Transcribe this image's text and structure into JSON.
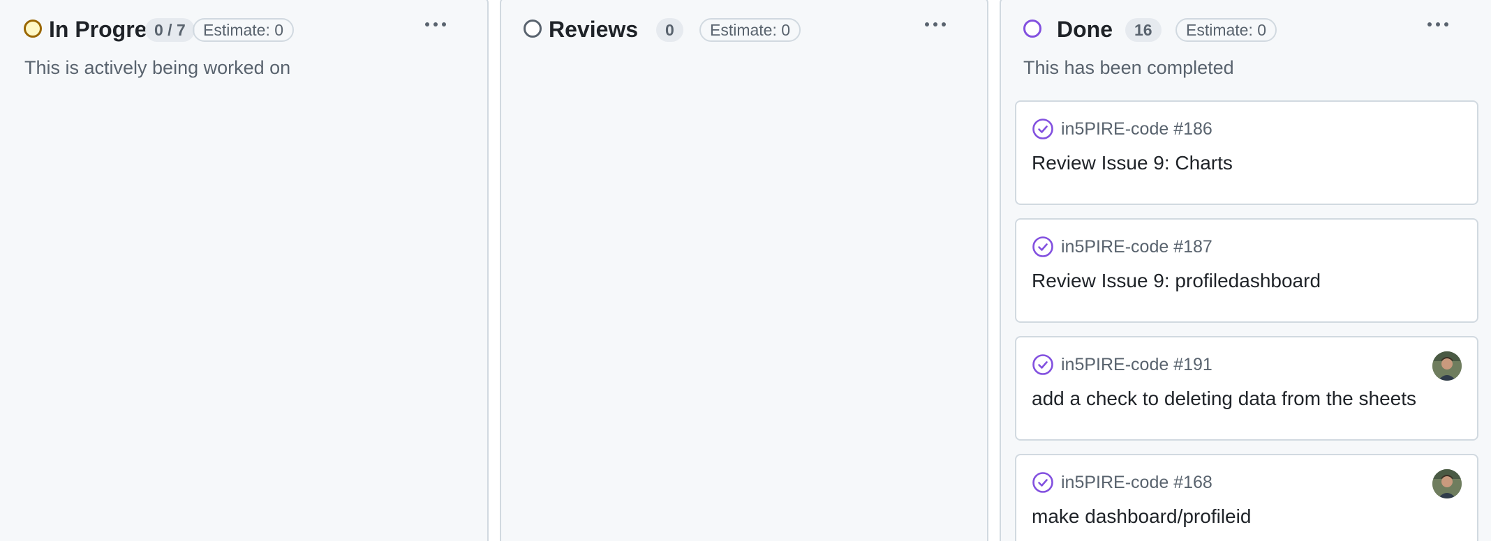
{
  "columns": {
    "in_progress": {
      "title": "In Progress",
      "count": "0 / 7",
      "estimate": "Estimate: 0",
      "description": "This is actively being worked on",
      "status_color": "#9a6700"
    },
    "reviews": {
      "title": "Reviews",
      "count": "0",
      "estimate": "Estimate: 0",
      "description": "",
      "status_color": "#59636e"
    },
    "done": {
      "title": "Done",
      "count": "16",
      "estimate": "Estimate: 0",
      "description": "This has been completed",
      "status_color": "#8250df",
      "cards": [
        {
          "ref": "in5PIRE-code #186",
          "title": "Review Issue 9: Charts",
          "has_avatar": false,
          "icon": "check-circle-icon"
        },
        {
          "ref": "in5PIRE-code #187",
          "title": "Review Issue 9: profiledashboard",
          "has_avatar": false,
          "icon": "check-circle-icon"
        },
        {
          "ref": "in5PIRE-code #191",
          "title": "add a check to deleting data from the sheets",
          "has_avatar": true,
          "icon": "check-circle-icon"
        },
        {
          "ref": "in5PIRE-code #168",
          "title": "make dashboard/profileid",
          "has_avatar": true,
          "icon": "check-circle-icon"
        }
      ]
    }
  },
  "icons": {
    "more": "kebab-horizontal-icon",
    "check": "check-circle-icon",
    "status": "status-circle-icon"
  },
  "colors": {
    "accent_done": "#8250df",
    "in_progress": "#9a6700",
    "muted": "#59636e",
    "border": "#d1d9e0",
    "column_bg": "#f6f8fa"
  }
}
